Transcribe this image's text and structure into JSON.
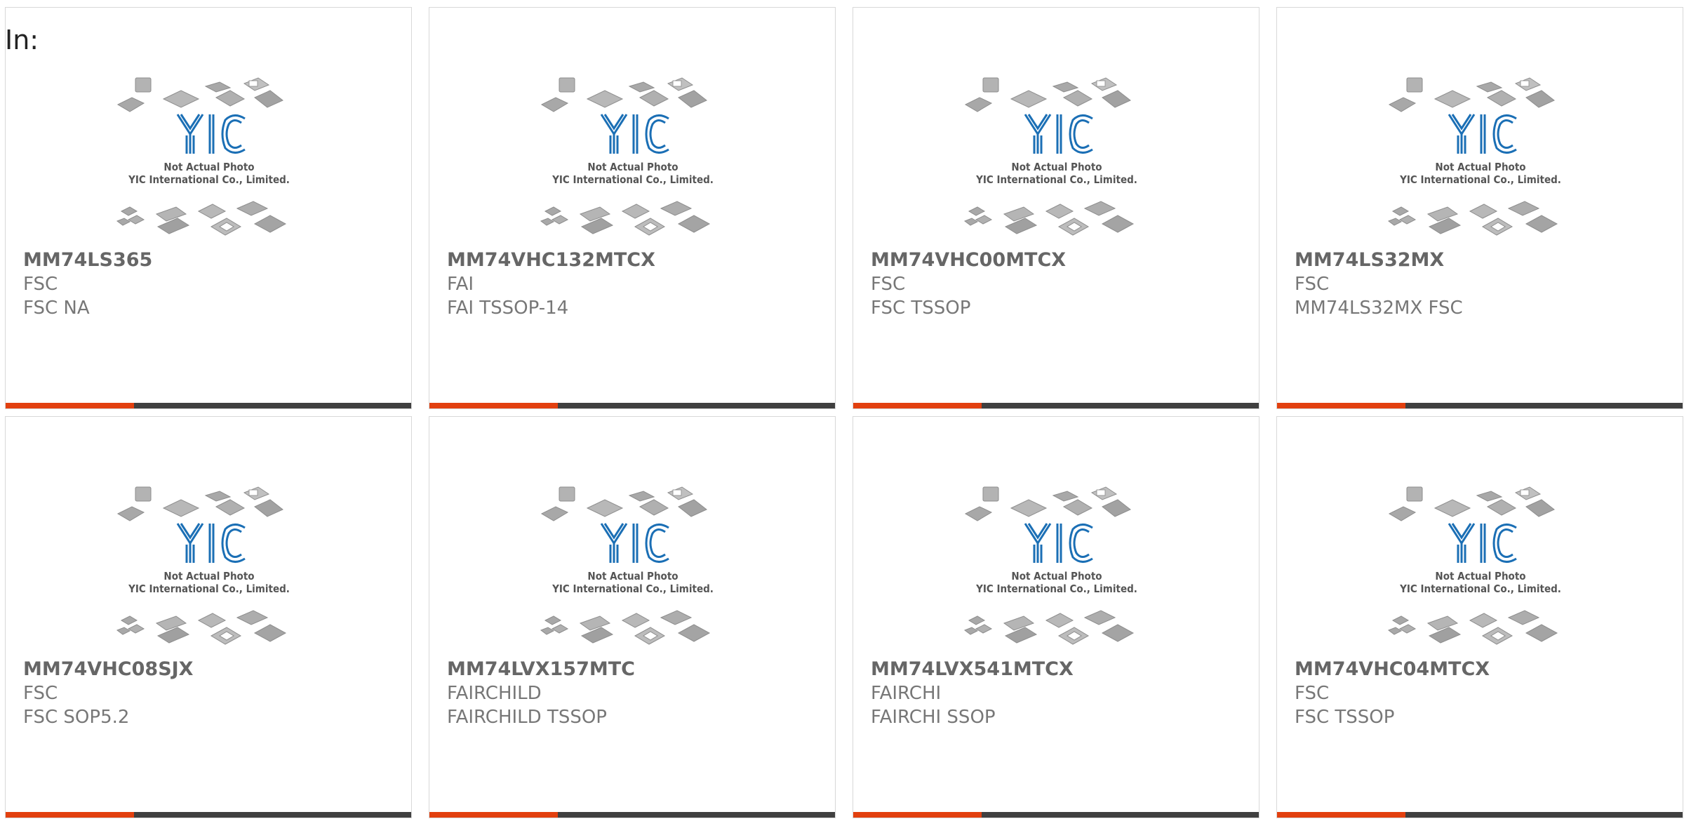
{
  "page": {
    "label": "In:"
  },
  "placeholder": {
    "line1": "Not Actual Photo",
    "line2": "YIC International Co., Limited.",
    "logo_text": "YIC",
    "logo_color": "#1b6fb5"
  },
  "colors": {
    "accent": "#e2400f",
    "bar": "#404040"
  },
  "products": [
    {
      "part": "MM74LS365",
      "brand": "FSC",
      "desc": "FSC NA"
    },
    {
      "part": "MM74VHC132MTCX",
      "brand": "FAI",
      "desc": "FAI TSSOP-14"
    },
    {
      "part": "MM74VHC00MTCX",
      "brand": "FSC",
      "desc": "FSC TSSOP"
    },
    {
      "part": "MM74LS32MX",
      "brand": "FSC",
      "desc": "MM74LS32MX FSC"
    },
    {
      "part": "MM74VHC08SJX",
      "brand": "FSC",
      "desc": "FSC SOP5.2"
    },
    {
      "part": "MM74LVX157MTC",
      "brand": "FAIRCHILD",
      "desc": "FAIRCHILD TSSOP"
    },
    {
      "part": "MM74LVX541MTCX",
      "brand": "FAIRCHI",
      "desc": "FAIRCHI SSOP"
    },
    {
      "part": "MM74VHC04MTCX",
      "brand": "FSC",
      "desc": "FSC TSSOP"
    }
  ]
}
